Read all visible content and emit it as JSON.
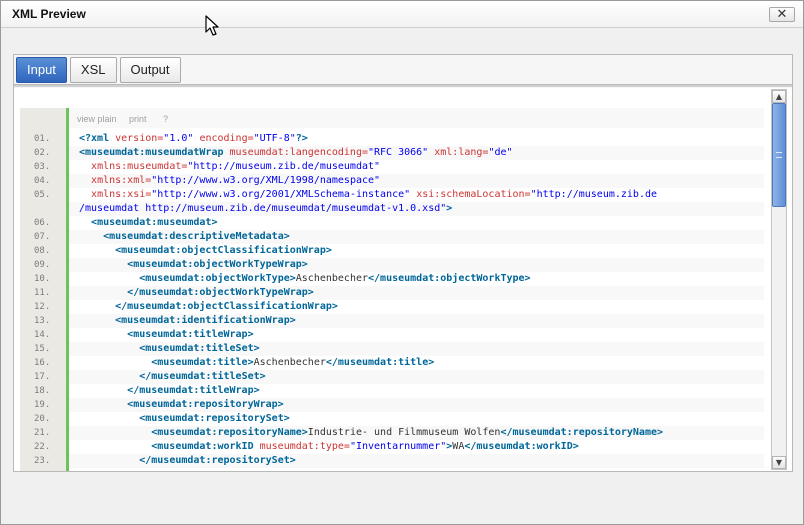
{
  "window": {
    "title": "XML Preview",
    "close_label": "✕"
  },
  "tabs": [
    {
      "label": "Input",
      "active": true
    },
    {
      "label": "XSL",
      "active": false
    },
    {
      "label": "Output",
      "active": false
    }
  ],
  "toolbar": {
    "view_plain": "view plain",
    "print": "print",
    "help": "?"
  },
  "scrollbar": {
    "up_glyph": "▲",
    "down_glyph": "▼"
  },
  "code": {
    "colors": {
      "tag": "#006699",
      "attr": "#cc3333",
      "value": "#0000ee",
      "gutter_border": "#6cc45d"
    },
    "lines": [
      {
        "ln": "01.",
        "tokens": [
          [
            "tag",
            "<?xml "
          ],
          [
            "attr",
            "version="
          ],
          [
            "val",
            "\"1.0\""
          ],
          [
            "txt",
            " "
          ],
          [
            "attr",
            "encoding="
          ],
          [
            "val",
            "\"UTF-8\""
          ],
          [
            "tag",
            "?>"
          ]
        ]
      },
      {
        "ln": "02.",
        "tokens": [
          [
            "tag",
            "<museumdat:museumdatWrap "
          ],
          [
            "attr",
            "museumdat:langencoding="
          ],
          [
            "val",
            "\"RFC 3066\""
          ],
          [
            "txt",
            " "
          ],
          [
            "attr",
            "xml:lang="
          ],
          [
            "val",
            "\"de\""
          ]
        ]
      },
      {
        "ln": "03.",
        "tokens": [
          [
            "txt",
            "  "
          ],
          [
            "attr",
            "xmlns:museumdat="
          ],
          [
            "val",
            "\"http://museum.zib.de/museumdat\""
          ]
        ]
      },
      {
        "ln": "04.",
        "tokens": [
          [
            "txt",
            "  "
          ],
          [
            "attr",
            "xmlns:xml="
          ],
          [
            "val",
            "\"http://www.w3.org/XML/1998/namespace\""
          ]
        ]
      },
      {
        "ln": "05.",
        "tokens": [
          [
            "txt",
            "  "
          ],
          [
            "attr",
            "xmlns:xsi="
          ],
          [
            "val",
            "\"http://www.w3.org/2001/XMLSchema-instance\""
          ],
          [
            "txt",
            " "
          ],
          [
            "attr",
            "xsi:schemaLocation="
          ],
          [
            "val",
            "\"http://museum.zib.de"
          ]
        ]
      },
      {
        "ln": "",
        "tokens": [
          [
            "val",
            "/museumdat http://museum.zib.de/museumdat/museumdat-v1.0.xsd\""
          ],
          [
            "tag",
            ">"
          ]
        ]
      },
      {
        "ln": "06.",
        "tokens": [
          [
            "txt",
            "  "
          ],
          [
            "tag",
            "<museumdat:museumdat>"
          ]
        ]
      },
      {
        "ln": "07.",
        "tokens": [
          [
            "txt",
            "    "
          ],
          [
            "tag",
            "<museumdat:descriptiveMetadata>"
          ]
        ]
      },
      {
        "ln": "08.",
        "tokens": [
          [
            "txt",
            "      "
          ],
          [
            "tag",
            "<museumdat:objectClassificationWrap>"
          ]
        ]
      },
      {
        "ln": "09.",
        "tokens": [
          [
            "txt",
            "        "
          ],
          [
            "tag",
            "<museumdat:objectWorkTypeWrap>"
          ]
        ]
      },
      {
        "ln": "10.",
        "tokens": [
          [
            "txt",
            "          "
          ],
          [
            "tag",
            "<museumdat:objectWorkType>"
          ],
          [
            "txt",
            "Aschenbecher"
          ],
          [
            "tag",
            "</museumdat:objectWorkType>"
          ]
        ]
      },
      {
        "ln": "11.",
        "tokens": [
          [
            "txt",
            "        "
          ],
          [
            "tag",
            "</museumdat:objectWorkTypeWrap>"
          ]
        ]
      },
      {
        "ln": "12.",
        "tokens": [
          [
            "txt",
            "      "
          ],
          [
            "tag",
            "</museumdat:objectClassificationWrap>"
          ]
        ]
      },
      {
        "ln": "13.",
        "tokens": [
          [
            "txt",
            "      "
          ],
          [
            "tag",
            "<museumdat:identificationWrap>"
          ]
        ]
      },
      {
        "ln": "14.",
        "tokens": [
          [
            "txt",
            "        "
          ],
          [
            "tag",
            "<museumdat:titleWrap>"
          ]
        ]
      },
      {
        "ln": "15.",
        "tokens": [
          [
            "txt",
            "          "
          ],
          [
            "tag",
            "<museumdat:titleSet>"
          ]
        ]
      },
      {
        "ln": "16.",
        "tokens": [
          [
            "txt",
            "            "
          ],
          [
            "tag",
            "<museumdat:title>"
          ],
          [
            "txt",
            "Aschenbecher"
          ],
          [
            "tag",
            "</museumdat:title>"
          ]
        ]
      },
      {
        "ln": "17.",
        "tokens": [
          [
            "txt",
            "          "
          ],
          [
            "tag",
            "</museumdat:titleSet>"
          ]
        ]
      },
      {
        "ln": "18.",
        "tokens": [
          [
            "txt",
            "        "
          ],
          [
            "tag",
            "</museumdat:titleWrap>"
          ]
        ]
      },
      {
        "ln": "19.",
        "tokens": [
          [
            "txt",
            "        "
          ],
          [
            "tag",
            "<museumdat:repositoryWrap>"
          ]
        ]
      },
      {
        "ln": "20.",
        "tokens": [
          [
            "txt",
            "          "
          ],
          [
            "tag",
            "<museumdat:repositorySet>"
          ]
        ]
      },
      {
        "ln": "21.",
        "tokens": [
          [
            "txt",
            "            "
          ],
          [
            "tag",
            "<museumdat:repositoryName>"
          ],
          [
            "txt",
            "Industrie- und Filmmuseum Wolfen"
          ],
          [
            "tag",
            "</museumdat:repositoryName>"
          ]
        ]
      },
      {
        "ln": "22.",
        "tokens": [
          [
            "txt",
            "            "
          ],
          [
            "tag",
            "<museumdat:workID "
          ],
          [
            "attr",
            "museumdat:type="
          ],
          [
            "val",
            "\"Inventarnummer\""
          ],
          [
            "tag",
            ">"
          ],
          [
            "txt",
            "WA"
          ],
          [
            "tag",
            "</museumdat:workID>"
          ]
        ]
      },
      {
        "ln": "23.",
        "tokens": [
          [
            "txt",
            "          "
          ],
          [
            "tag",
            "</museumdat:repositorySet>"
          ]
        ]
      }
    ]
  }
}
